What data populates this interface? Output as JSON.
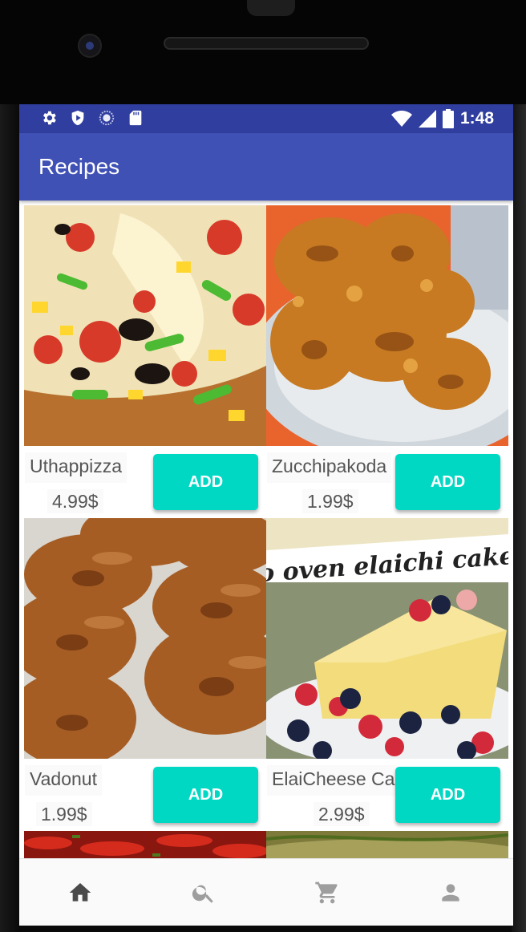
{
  "status_bar": {
    "time": "1:48",
    "icons_left": [
      "gear-icon",
      "shield-play-icon",
      "loading-circle-icon",
      "sd-card-icon"
    ],
    "icons_right": [
      "wifi-icon",
      "signal-icon",
      "battery-icon"
    ]
  },
  "app_bar": {
    "title": "Recipes",
    "color": "#3f51b5",
    "status_color": "#303f9f"
  },
  "products": [
    {
      "name": "Uthappizza",
      "price": "4.99$",
      "button": "ADD",
      "image": "pizza"
    },
    {
      "name": "Zucchipakoda",
      "price": "1.99$",
      "button": "ADD",
      "image": "pakoda"
    },
    {
      "name": "Vadonut",
      "price": "1.99$",
      "button": "ADD",
      "image": "donuts"
    },
    {
      "name": "ElaiCheese Cake",
      "price": "2.99$",
      "button": "ADD",
      "image": "cake",
      "image_caption": "o oven elaichi cake"
    }
  ],
  "accent_color": "#00d8c4",
  "bottom_nav": {
    "items": [
      {
        "icon": "home-icon",
        "active": true
      },
      {
        "icon": "search-icon",
        "active": false
      },
      {
        "icon": "cart-icon",
        "active": false
      },
      {
        "icon": "person-icon",
        "active": false
      }
    ]
  }
}
